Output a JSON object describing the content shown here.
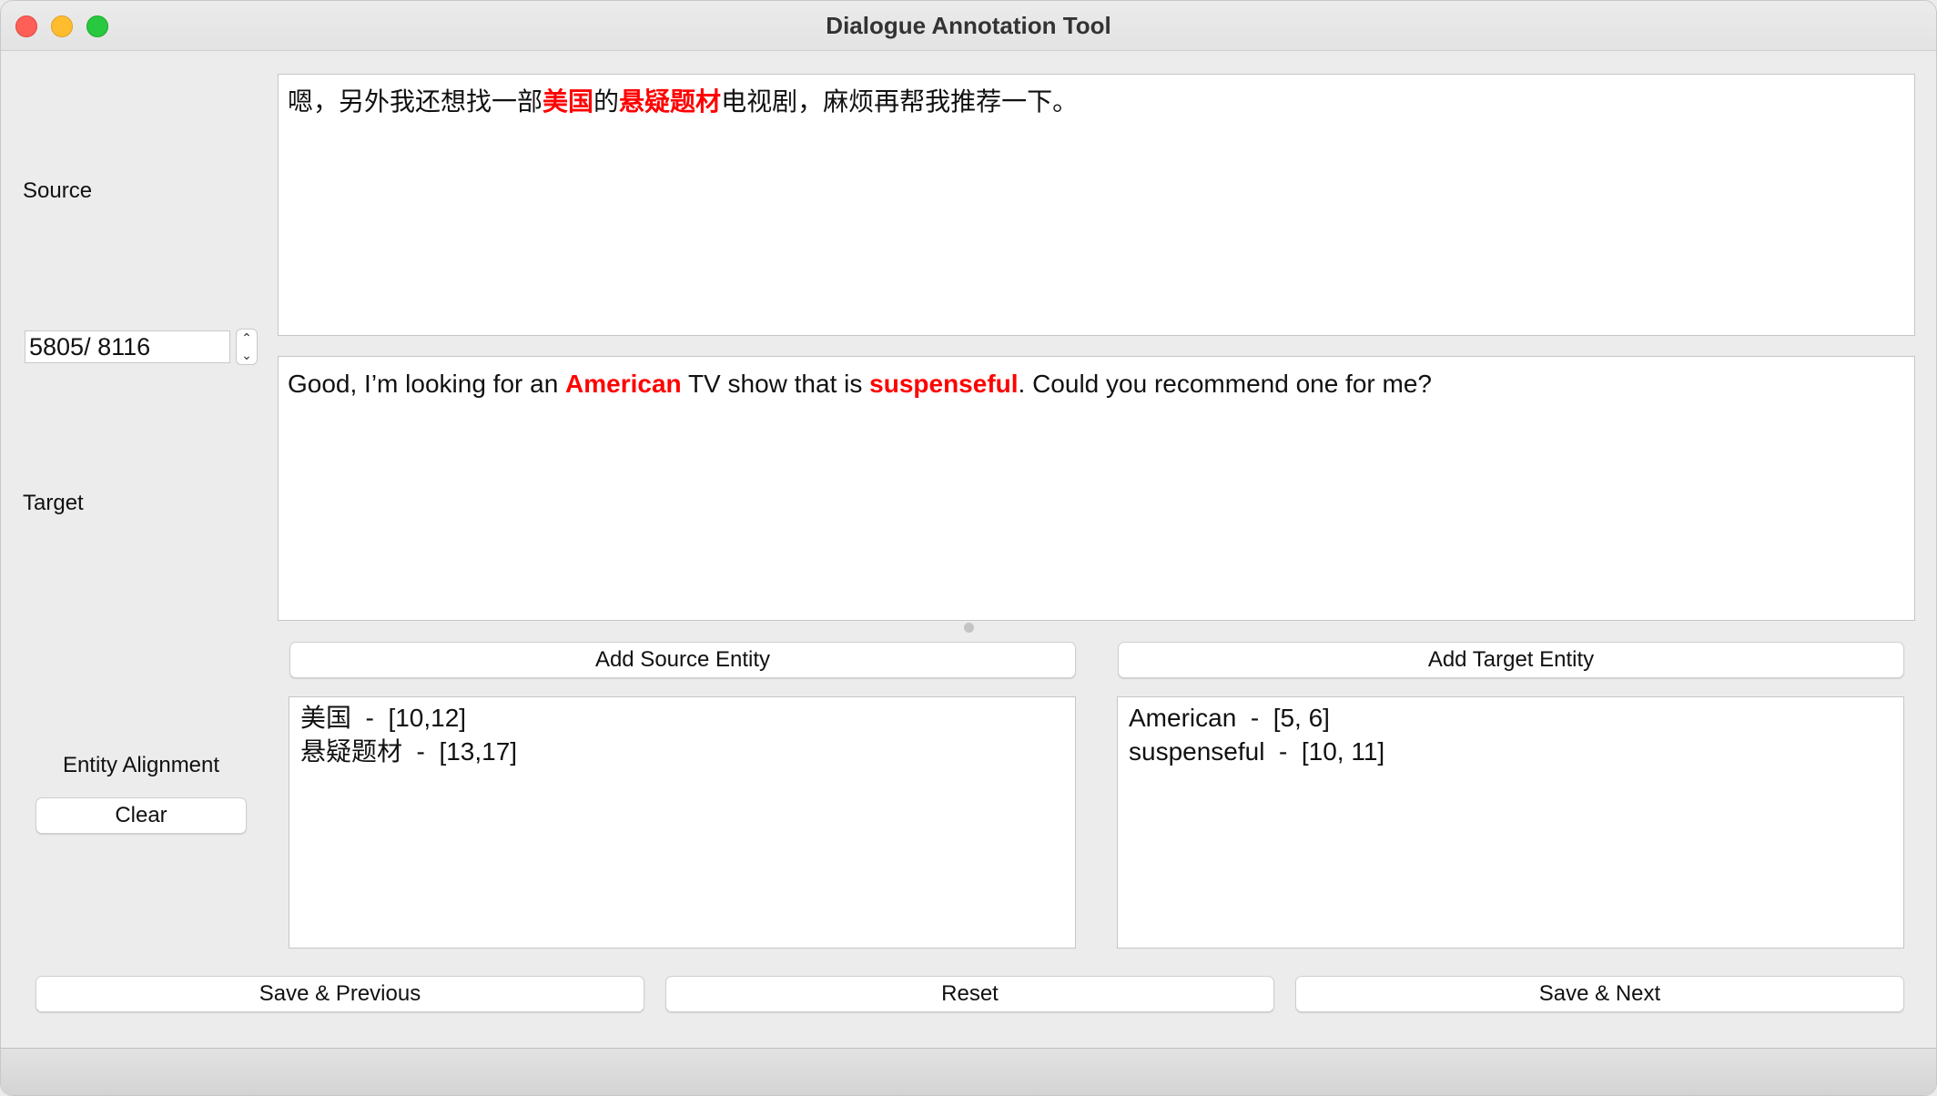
{
  "window": {
    "title": "Dialogue Annotation Tool"
  },
  "labels": {
    "source": "Source",
    "target": "Target",
    "entity_alignment": "Entity Alignment"
  },
  "counter": {
    "value": "5805/ 8116"
  },
  "source_text": {
    "seg1": "嗯，另外我还想找一部",
    "ent1": "美国",
    "seg2": "的",
    "ent2": "悬疑题材",
    "seg3": "电视剧，麻烦再帮我推荐一下。"
  },
  "target_text": {
    "seg1": "Good, I’m looking for an ",
    "ent1": "American",
    "seg2": " TV show that is ",
    "ent2": "suspenseful",
    "seg3": ". Could you recommend one for me?"
  },
  "buttons": {
    "add_source_entity": "Add Source Entity",
    "add_target_entity": "Add Target Entity",
    "clear": "Clear",
    "save_previous": "Save & Previous",
    "reset": "Reset",
    "save_next": "Save & Next"
  },
  "source_entities": [
    "美国  -  [10,12]",
    "悬疑题材  -  [13,17]"
  ],
  "target_entities": [
    "American  -  [5, 6]",
    "suspenseful  -  [10, 11]"
  ],
  "colors": {
    "highlight": "#ff0000",
    "close": "#fe5f57",
    "minimize": "#febc2e",
    "maximize": "#28c840"
  },
  "icons": {
    "stepper": "up-down-chevron-icon"
  }
}
